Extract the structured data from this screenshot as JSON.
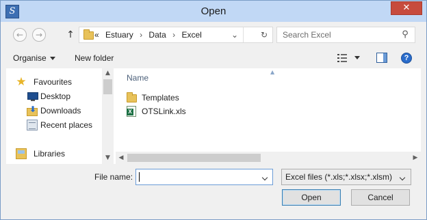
{
  "window": {
    "title": "Open",
    "app_icon_glyph": "S",
    "close_glyph": "✕"
  },
  "nav": {
    "back_glyph": "←",
    "forward_glyph": "→",
    "up_glyph": "↑"
  },
  "address": {
    "overflow_glyph": "«",
    "separator_glyph": "›",
    "crumbs": [
      "Estuary",
      "Data",
      "Excel"
    ],
    "dropdown_glyph": "⌄",
    "refresh_glyph": "↻"
  },
  "search": {
    "placeholder": "Search Excel",
    "icon_glyph": "⚲"
  },
  "toolbar": {
    "organise_label": "Organise",
    "new_folder_label": "New folder",
    "help_glyph": "?"
  },
  "sidebar": {
    "favourites_label": "Favourites",
    "star_glyph": "★",
    "items": [
      {
        "label": "Desktop",
        "icon": "desktop-icon"
      },
      {
        "label": "Downloads",
        "icon": "downloads-folder-icon"
      },
      {
        "label": "Recent places",
        "icon": "recent-places-icon"
      }
    ],
    "libraries_label": "Libraries",
    "scroll_up_glyph": "▲",
    "scroll_down_glyph": "▼",
    "download_arrow_glyph": "⬇"
  },
  "file_list": {
    "column_name": "Name",
    "sort_glyph": "▲",
    "rows": [
      {
        "name": "Templates",
        "type": "folder"
      },
      {
        "name": "OTSLink.xls",
        "type": "excel-file"
      }
    ],
    "scroll_left_glyph": "◀",
    "scroll_right_glyph": "▶"
  },
  "footer": {
    "file_name_label": "File name:",
    "file_name_value": "",
    "file_type_value": "Excel files (*.xls;*.xlsx;*.xlsm)",
    "open_label": "Open",
    "cancel_label": "Cancel"
  },
  "colors": {
    "titlebar": "#c1d8f5",
    "close": "#c74b3d",
    "folder": "#e8c25a",
    "accent": "#2a6ccb"
  }
}
